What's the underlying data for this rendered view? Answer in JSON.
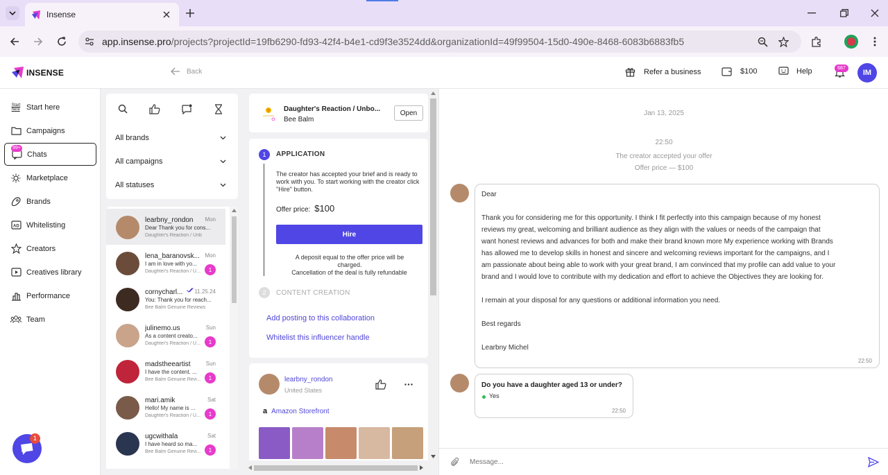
{
  "browser": {
    "tab_title": "Insense",
    "url_host": "app.insense.pro",
    "url_path": "/projects?projectId=19fb6290-fd93-42f4-b4e1-cd9f3e3524dd&organizationId=49f99504-15d0-490e-8468-6083b6883fb5"
  },
  "header": {
    "brand": "INSENSE",
    "back": "Back",
    "refer": "Refer a business",
    "balance": "$100",
    "help": "Help",
    "notif_count": "687",
    "avatar_initials": "IM"
  },
  "sidebar": {
    "chats_badge": "99+",
    "items": [
      {
        "label": "Start here",
        "icon": "start-here-icon"
      },
      {
        "label": "Campaigns",
        "icon": "folder-icon"
      },
      {
        "label": "Chats",
        "icon": "chat-icon"
      },
      {
        "label": "Marketplace",
        "icon": "sun-icon"
      },
      {
        "label": "Brands",
        "icon": "brands-icon"
      },
      {
        "label": "Whitelisting",
        "icon": "ad-icon"
      },
      {
        "label": "Creators",
        "icon": "star-icon"
      },
      {
        "label": "Creatives library",
        "icon": "play-icon"
      },
      {
        "label": "Performance",
        "icon": "chart-icon"
      },
      {
        "label": "Team",
        "icon": "team-icon"
      }
    ],
    "help_bubble_badge": "1"
  },
  "filters": {
    "brands": "All brands",
    "campaigns": "All campaigns",
    "statuses": "All statuses"
  },
  "chats": [
    {
      "name": "learbny_rondon",
      "date": "Mon",
      "preview": "Dear Thank you for cons...",
      "campaign": "Daughter's Reaction / Unboxi...",
      "badge": "",
      "avatar_color": "#b58a6a"
    },
    {
      "name": "lena_baranovsk...",
      "date": "Mon",
      "preview": "I am in love with yo...",
      "campaign": "Daughter's Reaction / U...",
      "badge": "1",
      "avatar_color": "#6b4c3b"
    },
    {
      "name": "cornycharl...",
      "date": "11.25.24",
      "preview": "You: Thank you for reach...",
      "campaign": "Bee Balm Genuine Reviews",
      "badge": "",
      "avatar_color": "#3d2b22"
    },
    {
      "name": "julinemo.us",
      "date": "Sun",
      "preview": "As a content creato...",
      "campaign": "Daughter's Reaction / U...",
      "badge": "1",
      "avatar_color": "#c9a48a"
    },
    {
      "name": "madstheeartist",
      "date": "Sun",
      "preview": "I have the content. ...",
      "campaign": "Bee Balm Genuine Revi...",
      "badge": "1",
      "avatar_color": "#c0243a"
    },
    {
      "name": "mari.amik",
      "date": "Sat",
      "preview": "Hello! My name is ...",
      "campaign": "Daughter's Reaction / U...",
      "badge": "1",
      "avatar_color": "#7a5a48"
    },
    {
      "name": "ugcwithala",
      "date": "Sat",
      "preview": "I have heard so ma...",
      "campaign": "Bee Balm Genuine Revi...",
      "badge": "1",
      "avatar_color": "#2a3550"
    }
  ],
  "campaign": {
    "title": "Daughter's Reaction / Unbo...",
    "brand": "Bee Balm",
    "open_btn": "Open"
  },
  "application": {
    "step1_num": "1",
    "step1_title": "APPLICATION",
    "desc": "The creator has accepted your brief and is ready to work with you. To start working with the creator click \"Hire\" button.",
    "offer_label": "Offer price:",
    "offer_value": "$100",
    "hire_btn": "Hire",
    "deposit_note": "A deposit equal to the offer price will be charged.",
    "cancel_note": "Cancellation of the deal is fully refundable",
    "step2_num": "2",
    "step2_title": "CONTENT CREATION",
    "link1": "Add posting to this collaboration",
    "link2": "Whitelist this influencer handle"
  },
  "creator": {
    "handle": "learbny_rondon",
    "country": "United States",
    "storefront": "Amazon Storefront",
    "thumb_colors": [
      "#8a5bc4",
      "#b77fc9",
      "#c78a6a",
      "#d7b8a0",
      "#c5a07a"
    ]
  },
  "conversation": {
    "date": "Jan 13, 2025",
    "sys_time": "22:50",
    "sys_line1": "The creator accepted your offer",
    "sys_line2": "Offer price — $100",
    "msg1_lines": [
      "Dear",
      "",
      "Thank you for considering me for this opportunity. I think I fit perfectly into this campaign because of my honest",
      "reviews my great, welcoming and brilliant audience as they align with the values or needs of the campaign that",
      "want honest reviews and advances for both and make their brand known more My experience working with Brands",
      "has allowed me to develop skills in honest and sincere and welcoming reviews important for the campaigns, and I",
      "am passionate about being able to work with your great brand, I am convinced that my profile can add value to your",
      "brand and I would love to contribute with my dedication and effort to achieve the Objectives they are looking for.",
      "",
      "I remain at your disposal for any questions or additional information you need.",
      "",
      "Best regards",
      "",
      "Learbny Michel"
    ],
    "msg1_time": "22:50",
    "msg2_question": "Do you have a daughter aged 13 or under?",
    "msg2_answer": "Yes",
    "msg2_time": "22:50",
    "input_placeholder": "Message..."
  },
  "colors": {
    "accent": "#4f46e5",
    "badge": "#e63bcb"
  }
}
